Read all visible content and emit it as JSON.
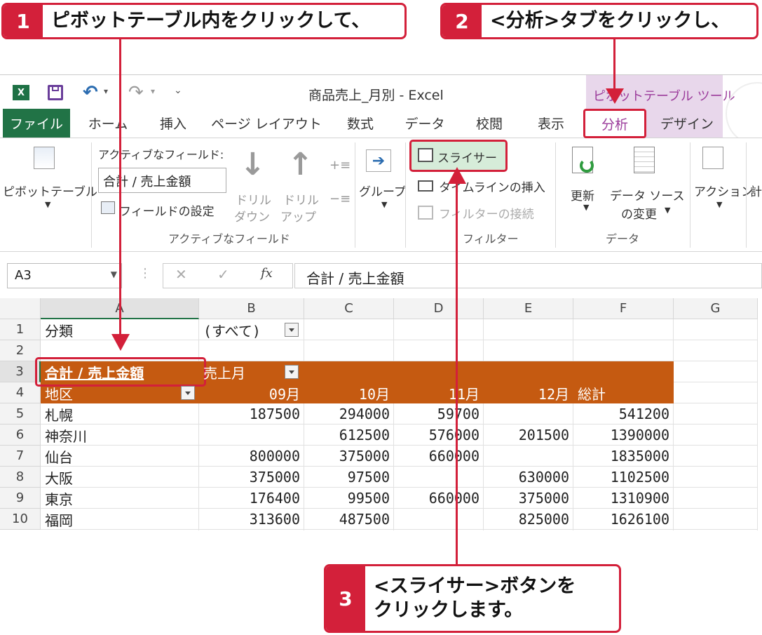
{
  "callouts": {
    "step1": {
      "num": "1",
      "text": "ピボットテーブル内をクリックして、"
    },
    "step2": {
      "num": "2",
      "text": "<分析>タブをクリックし、"
    },
    "step3": {
      "num": "3",
      "line1": "<スライサー>ボタンを",
      "line2": "クリックします。"
    }
  },
  "window": {
    "title": "商品売上_月別 - Excel",
    "context_tab_group": "ピボットテーブル ツール"
  },
  "tabs": {
    "file": "ファイル",
    "home": "ホーム",
    "insert": "挿入",
    "page_layout": "ページ レイアウト",
    "formulas": "数式",
    "data": "データ",
    "review": "校閲",
    "view": "表示",
    "analyze": "分析",
    "design": "デザイン"
  },
  "ribbon": {
    "pivottable_button": "ピボットテーブル",
    "active_field_label": "アクティブなフィールド:",
    "active_field_value": "合計 / 売上金額",
    "field_settings": "フィールドの設定",
    "drill_down_1": "ドリル",
    "drill_down_2": "ダウン",
    "drill_up_1": "ドリル",
    "drill_up_2": "アップ",
    "group_active_field": "アクティブなフィールド",
    "group_button": "グループ",
    "slicer": "スライサー",
    "timeline": "タイムラインの挿入",
    "filter_connections": "フィルターの接続",
    "group_filter": "フィルター",
    "refresh": "更新",
    "change_source_1": "データ ソース",
    "change_source_2": "の変更",
    "group_data": "データ",
    "actions": "アクション",
    "calc_partial": "計"
  },
  "formula_bar": {
    "name_box": "A3",
    "formula": "合計 / 売上金額",
    "fx": "fx"
  },
  "sheet": {
    "columns": [
      "A",
      "B",
      "C",
      "D",
      "E",
      "F",
      "G"
    ],
    "rows": [
      "1",
      "2",
      "3",
      "4",
      "5",
      "6",
      "7",
      "8",
      "9",
      "10"
    ],
    "filter_label": "分類",
    "filter_value": "(すべて)",
    "sum_label": "合計 / 売上金額",
    "col_field": "売上月",
    "row_field": "地区",
    "months": [
      "09月",
      "10月",
      "11月",
      "12月"
    ],
    "total_label": "総計",
    "data": [
      {
        "region": "札幌",
        "m09": "187500",
        "m10": "294000",
        "m11": "59700",
        "m12": "",
        "total": "541200"
      },
      {
        "region": "神奈川",
        "m09": "",
        "m10": "612500",
        "m11": "576000",
        "m12": "201500",
        "total": "1390000"
      },
      {
        "region": "仙台",
        "m09": "800000",
        "m10": "375000",
        "m11": "660000",
        "m12": "",
        "total": "1835000"
      },
      {
        "region": "大阪",
        "m09": "375000",
        "m10": "97500",
        "m11": "",
        "m12": "630000",
        "total": "1102500"
      },
      {
        "region": "東京",
        "m09": "176400",
        "m10": "99500",
        "m11": "660000",
        "m12": "375000",
        "total": "1310900"
      },
      {
        "region": "福岡",
        "m09": "313600",
        "m10": "487500",
        "m11": "",
        "m12": "825000",
        "total": "1626100"
      }
    ]
  },
  "colors": {
    "accent_red": "#d3203a",
    "excel_green": "#217346",
    "pivot_orange": "#c55a11",
    "context_purple": "#e8d7eb"
  }
}
